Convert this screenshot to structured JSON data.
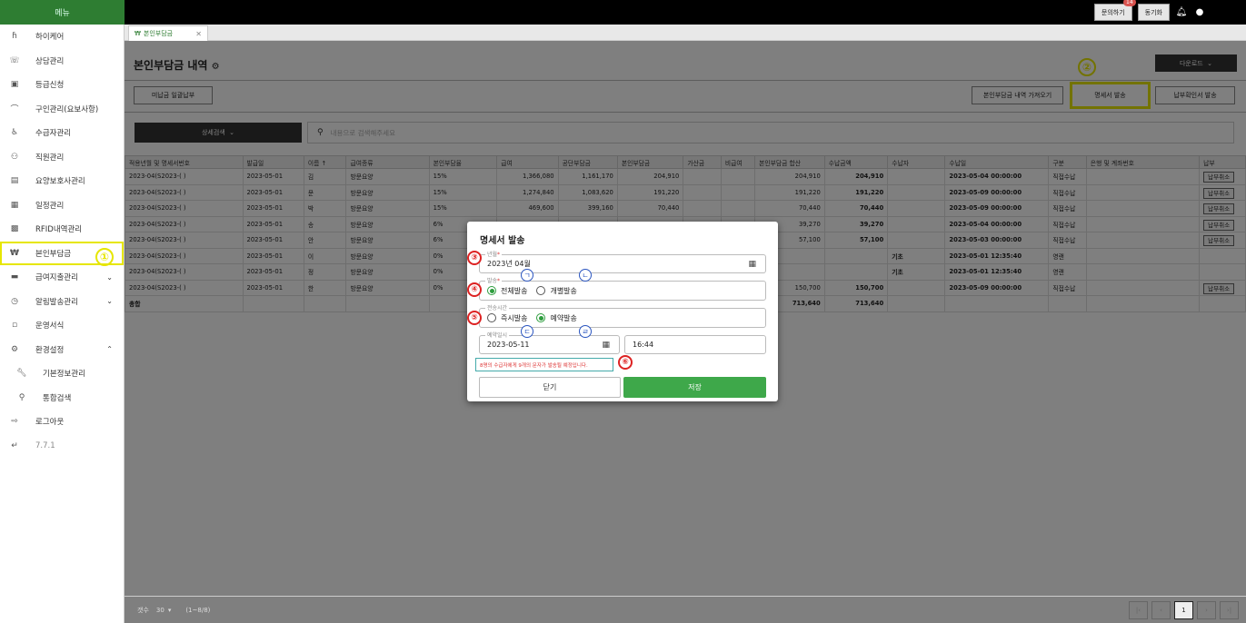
{
  "header": {
    "menu_label": "메뉴",
    "inquiry_label": "문의하기",
    "inquiry_badge": "14",
    "sync_label": "동기화"
  },
  "sidebar": {
    "items": [
      {
        "label": "하이케어",
        "icon": "logo-icon"
      },
      {
        "label": "상담관리",
        "icon": "phone-icon"
      },
      {
        "label": "등급신청",
        "icon": "id-card-icon"
      },
      {
        "label": "구인관리(요보사항)",
        "icon": "wifi-icon"
      },
      {
        "label": "수급자관리",
        "icon": "wheelchair-icon"
      },
      {
        "label": "직원관리",
        "icon": "people-icon"
      },
      {
        "label": "요양보호사관리",
        "icon": "person-card-icon"
      },
      {
        "label": "일정관리",
        "icon": "calendar-icon"
      },
      {
        "label": "RFID내역관리",
        "icon": "rfid-icon"
      },
      {
        "label": "본인부담금",
        "icon": "won-icon"
      },
      {
        "label": "급여지출관리",
        "icon": "money-icon"
      },
      {
        "label": "알림발송관리",
        "icon": "alarm-icon"
      },
      {
        "label": "운영서식",
        "icon": "document-icon"
      },
      {
        "label": "환경설정",
        "icon": "gear-icon"
      },
      {
        "label": "기본정보관리",
        "icon": "wrench-icon"
      },
      {
        "label": "통합검색",
        "icon": "search-icon"
      },
      {
        "label": "로그아웃",
        "icon": "logout-icon"
      },
      {
        "label": "7.7.1",
        "icon": "version-icon"
      }
    ]
  },
  "tab": {
    "label": "본인부담금"
  },
  "page": {
    "title": "본인부담금 내역",
    "download_label": "다운로드",
    "bulk_pay_label": "미납금 일괄납부",
    "import_label": "본인부담금 내역 가져오기",
    "statement_send_label": "명세서 발송",
    "receipt_send_label": "납부확인서 발송",
    "detail_search_label": "상세검색",
    "search_placeholder": "내용으로 검색해주세요"
  },
  "table": {
    "columns": [
      "적용년월 및 명세서번호",
      "발급일",
      "이름 ↑",
      "급여종류",
      "본인부담율",
      "급여",
      "공단부담금",
      "본인부담금",
      "가산금",
      "비급여",
      "본인부담금 합산",
      "수납금액",
      "수납자",
      "수납일",
      "구분",
      "은행 및 계좌번호",
      "납부"
    ],
    "rows": [
      [
        "2023-04(S2023-(          )",
        "2023-05-01",
        "김",
        "방문요양",
        "15%",
        "1,366,080",
        "1,161,170",
        "204,910",
        "",
        "",
        "204,910",
        "204,910",
        "",
        "2023-05-04 00:00:00",
        "직접수납",
        "",
        "납부취소"
      ],
      [
        "2023-04(S2023-(          )",
        "2023-05-01",
        "문",
        "방문요양",
        "15%",
        "1,274,840",
        "1,083,620",
        "191,220",
        "",
        "",
        "191,220",
        "191,220",
        "",
        "2023-05-09 00:00:00",
        "직접수납",
        "",
        "납부취소"
      ],
      [
        "2023-04(S2023-(          )",
        "2023-05-01",
        "박",
        "방문요양",
        "15%",
        "469,600",
        "399,160",
        "70,440",
        "",
        "",
        "70,440",
        "70,440",
        "",
        "2023-05-09 00:00:00",
        "직접수납",
        "",
        "납부취소"
      ],
      [
        "2023-04(S2023-(          )",
        "2023-05-01",
        "송",
        "방문요양",
        "6%",
        "",
        "",
        "",
        "",
        "",
        "39,270",
        "39,270",
        "",
        "2023-05-04 00:00:00",
        "직접수납",
        "",
        "납부취소"
      ],
      [
        "2023-04(S2023-(          )",
        "2023-05-01",
        "안",
        "방문요양",
        "6%",
        "",
        "",
        "",
        "",
        "",
        "57,100",
        "57,100",
        "",
        "2023-05-03 00:00:00",
        "직접수납",
        "",
        "납부취소"
      ],
      [
        "2023-04(S2023-(          )",
        "2023-05-01",
        "이",
        "방문요양",
        "0%",
        "",
        "",
        "",
        "",
        "",
        "",
        "",
        "기초",
        "2023-05-01 12:35:40",
        "영랜",
        "",
        ""
      ],
      [
        "2023-04(S2023-(          )",
        "2023-05-01",
        "정",
        "방문요양",
        "0%",
        "",
        "",
        "",
        "",
        "",
        "",
        "",
        "기초",
        "2023-05-01 12:35:40",
        "영랜",
        "",
        ""
      ],
      [
        "2023-04(S2023-(          )",
        "2023-05-01",
        "한",
        "방문요양",
        "0%",
        "",
        "",
        "",
        "",
        "",
        "150,700",
        "150,700",
        "",
        "2023-05-09 00:00:00",
        "직접수납",
        "",
        "납부취소"
      ]
    ],
    "total_label": "총합",
    "total_sum": "713,640",
    "total_paid": "713,640"
  },
  "footer": {
    "rows_label": "갯수",
    "rows_value": "30",
    "range": "(1~8/8)",
    "current_page": "1"
  },
  "modal": {
    "title": "명세서 발송",
    "month_label": "년월",
    "month_value": "2023년 04월",
    "send_label": "발송",
    "send_options": [
      "전체발송",
      "개별발송"
    ],
    "time_label": "전송시간",
    "time_options": [
      "즉시발송",
      "예약발송"
    ],
    "schedule_label": "예약일시",
    "schedule_date": "2023-05-11",
    "schedule_time": "16:44",
    "notice": "8명의 수급자에게 9개의 문자가 발송될 예정입니다.",
    "close_label": "닫기",
    "save_label": "저장"
  },
  "annotations": {
    "n1": "①",
    "n2": "②",
    "n3": "③",
    "n4": "④",
    "n5": "⑤",
    "n6": "⑥",
    "k1": "ㄱ",
    "k2": "ㄴ",
    "k3": "ㄷ",
    "k4": "ㄹ"
  }
}
